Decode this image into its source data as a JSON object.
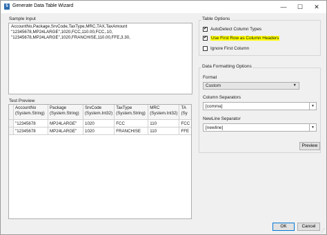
{
  "window": {
    "title": "Generate Data Table Wizard",
    "app_icon": "5",
    "controls": {
      "minimize": "—",
      "maximize": "☐",
      "close": "✕"
    }
  },
  "sample_input": {
    "label": "Sample Input",
    "lines": [
      "AccountNo,Package,SrvCode,TaxType,MRC,TAX,TaxAmount",
      "\"12345678,MP24LARGE\",1020,FCC,110.00,FCC,.10,",
      "\"12345678,MP24LARGE\",1020,FRANCHISE,110.00,FFE,3.30,"
    ]
  },
  "table_options": {
    "label": "Table Options",
    "checkboxes": [
      {
        "label": "AutoDetect Column Types",
        "checked": true,
        "mark": "✔",
        "highlighted": false
      },
      {
        "label": "Use First Row as Column Headers",
        "checked": true,
        "mark": "✔",
        "highlighted": true
      },
      {
        "label": "Ignore First Column",
        "checked": false,
        "mark": "",
        "highlighted": false
      }
    ]
  },
  "data_formatting": {
    "label": "Data Formatting Options",
    "format_label": "Format",
    "format_value": "Custom",
    "column_separators_label": "Column Separators",
    "column_separators_value": "[comma]",
    "newline_separator_label": "NewLine Separator",
    "newline_separator_value": "[newline]",
    "preview_button": "Preview"
  },
  "test_preview": {
    "label": "Test Preview",
    "columns": [
      {
        "name": "AccountNo",
        "type": "(System.String)"
      },
      {
        "name": "Package",
        "type": "(System.String)"
      },
      {
        "name": "SrvCode",
        "type": "(System.Int32)"
      },
      {
        "name": "TaxType",
        "type": "(System.String)"
      },
      {
        "name": "MRC",
        "type": "(System.Int32)"
      },
      {
        "name": "TA",
        "type": "(Sy"
      }
    ],
    "rows": [
      [
        "\"12345678",
        "MP24LARGE\"",
        "1020",
        "FCC",
        "110",
        "FCC"
      ],
      [
        "\"12345678",
        "MP24LARGE\"",
        "1020",
        "FRANCHISE",
        "110",
        "FFE"
      ]
    ]
  },
  "footer": {
    "ok": "OK",
    "cancel": "Cancel"
  },
  "colors": {
    "highlight": "#ffff00",
    "accent": "#0078d7"
  }
}
